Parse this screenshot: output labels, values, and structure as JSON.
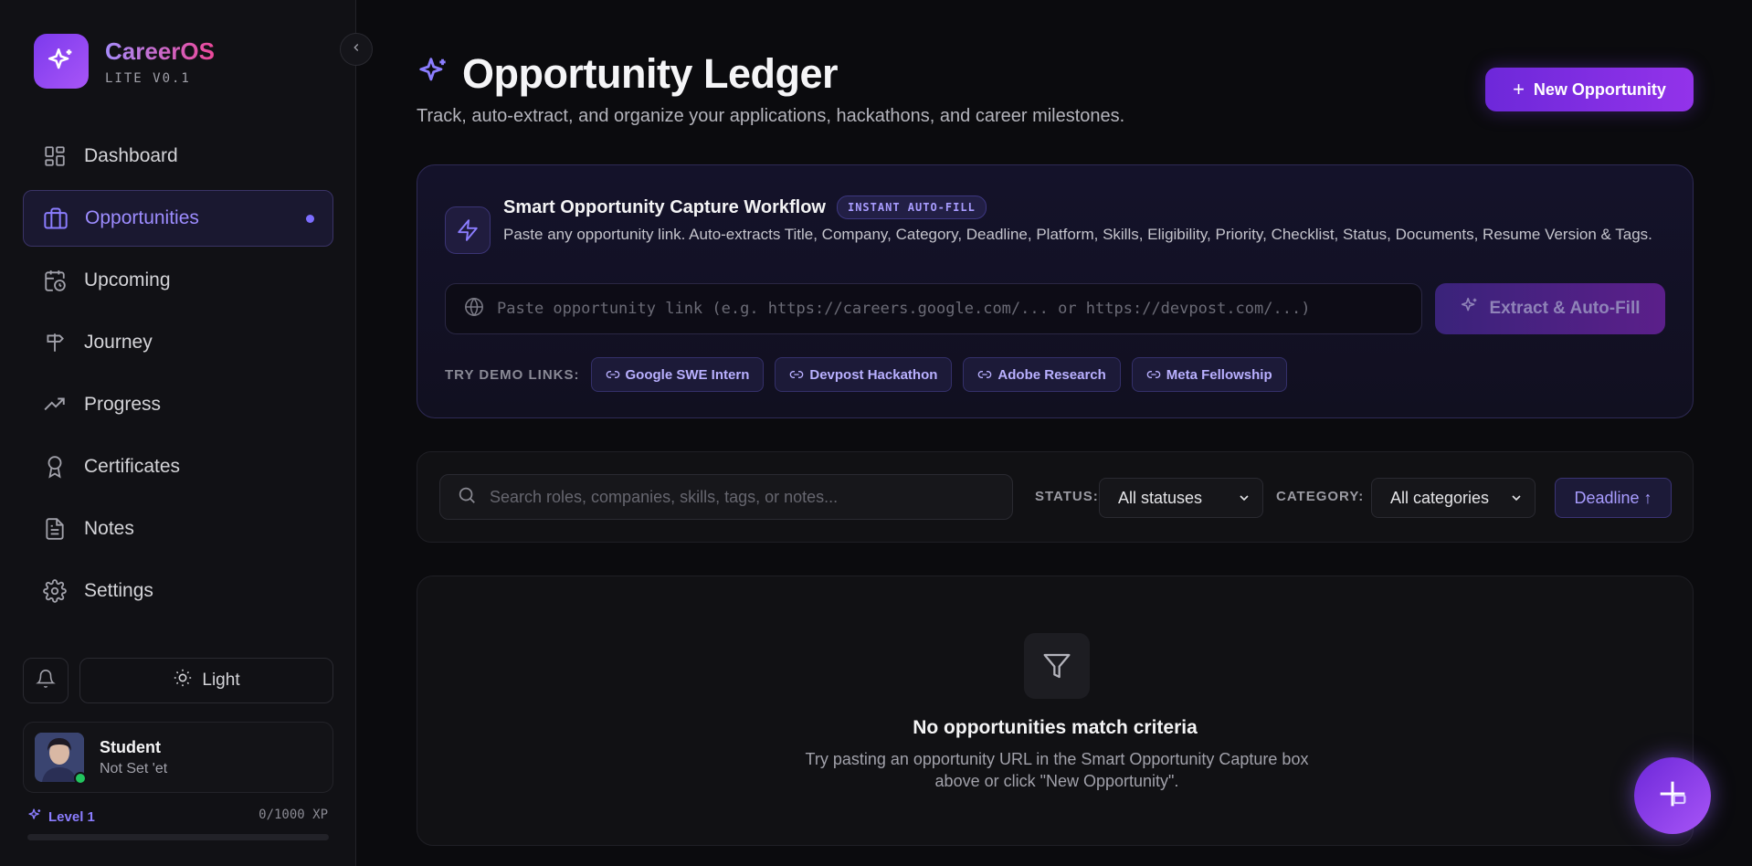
{
  "brand": {
    "name": "CareerOS",
    "version": "LITE V0.1"
  },
  "sidebar": {
    "items": [
      {
        "label": "Dashboard",
        "icon": "dashboard-icon"
      },
      {
        "label": "Opportunities",
        "icon": "briefcase-icon",
        "active": true
      },
      {
        "label": "Upcoming",
        "icon": "calendar-clock-icon"
      },
      {
        "label": "Journey",
        "icon": "signpost-icon"
      },
      {
        "label": "Progress",
        "icon": "trending-up-icon"
      },
      {
        "label": "Certificates",
        "icon": "award-icon"
      },
      {
        "label": "Notes",
        "icon": "document-icon"
      },
      {
        "label": "Settings",
        "icon": "gear-icon"
      }
    ],
    "theme_label": "Light",
    "user": {
      "name": "Student",
      "subtitle": "Not Set 'et"
    },
    "level": {
      "label": "Level 1",
      "xp": "0/1000 XP",
      "progress": 0
    }
  },
  "header": {
    "title": "Opportunity Ledger",
    "subtitle": "Track, auto-extract, and organize your applications, hackathons, and career milestones.",
    "new_button": "New Opportunity"
  },
  "capture": {
    "title": "Smart Opportunity Capture Workflow",
    "badge": "INSTANT AUTO-FILL",
    "description": "Paste any opportunity link. Auto-extracts Title, Company, Category, Deadline, Platform, Skills, Eligibility, Priority, Checklist, Status, Documents, Resume Version & Tags.",
    "input_placeholder": "Paste opportunity link (e.g. https://careers.google.com/... or https://devpost.com/...)",
    "extract_button": "Extract & Auto-Fill",
    "demo_label": "TRY DEMO LINKS:",
    "demo_links": [
      "Google SWE Intern",
      "Devpost Hackathon",
      "Adobe Research",
      "Meta Fellowship"
    ]
  },
  "filters": {
    "search_placeholder": "Search roles, companies, skills, tags, or notes...",
    "status_label": "STATUS:",
    "status_value": "All statuses",
    "category_label": "CATEGORY:",
    "category_value": "All categories",
    "sort_label": "Deadline ↑"
  },
  "empty_state": {
    "title": "No opportunities match criteria",
    "subtitle": "Try pasting an opportunity URL in the Smart Opportunity Capture box above or click \"New Opportunity\"."
  },
  "colors": {
    "accent": "#7c3aed",
    "accent_light": "#a89cff",
    "background": "#0b0b0e"
  }
}
